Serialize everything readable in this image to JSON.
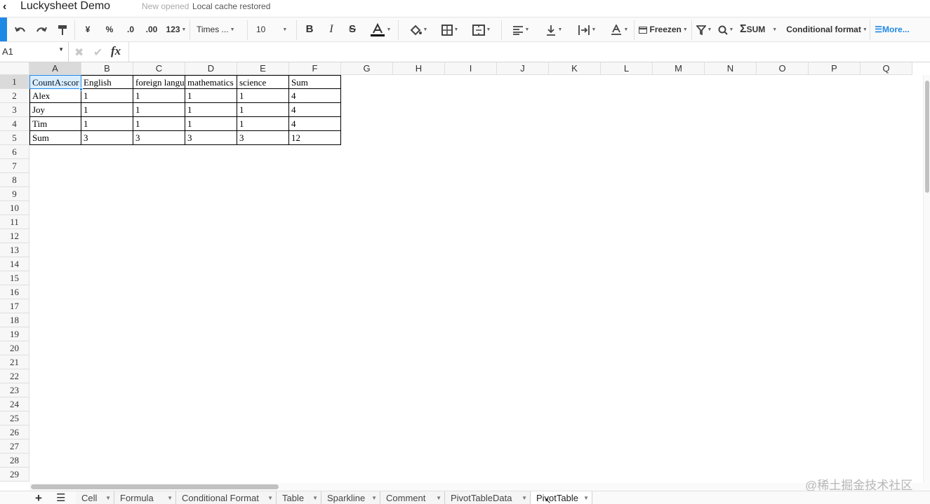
{
  "app": {
    "title": "Luckysheet Demo",
    "status_prefix": "New opened",
    "status": "Local cache restored"
  },
  "toolbar": {
    "font": "Times ...",
    "font_size": "10",
    "currency": "¥",
    "percent": "%",
    "dec_less": ".0",
    "dec_more": ".00",
    "format": "123",
    "freeze": "Freezen",
    "sum": "SUM",
    "conditional": "Conditional format",
    "more": "More...",
    "accent_color": "#1e88e5"
  },
  "formula_bar": {
    "cell_ref": "A1",
    "formula": ""
  },
  "columns": [
    "A",
    "B",
    "C",
    "D",
    "E",
    "F",
    "G",
    "H",
    "I",
    "J",
    "K",
    "L",
    "M",
    "N",
    "O",
    "P",
    "Q"
  ],
  "rows": [
    "1",
    "2",
    "3",
    "4",
    "5",
    "6",
    "7",
    "8",
    "9",
    "10",
    "11",
    "12",
    "13",
    "14",
    "15",
    "16",
    "17",
    "18",
    "19",
    "20",
    "21",
    "22",
    "23",
    "24",
    "25",
    "26",
    "27",
    "28",
    "29"
  ],
  "cells": [
    [
      "CountA:scor",
      "English",
      "foreign langu",
      "mathematics",
      "science",
      "Sum"
    ],
    [
      "Alex",
      "1",
      "1",
      "1",
      "1",
      "4"
    ],
    [
      "Joy",
      "1",
      "1",
      "1",
      "1",
      "4"
    ],
    [
      "Tim",
      "1",
      "1",
      "1",
      "1",
      "4"
    ],
    [
      "Sum",
      "3",
      "3",
      "3",
      "3",
      "12"
    ]
  ],
  "sheets": [
    "Cell",
    "Formula",
    "Conditional Format",
    "Table",
    "Sparkline",
    "Comment",
    "PivotTableData",
    "PivotTable"
  ],
  "active_sheet": "PivotTable",
  "watermark": "@稀土掘金技术社区"
}
